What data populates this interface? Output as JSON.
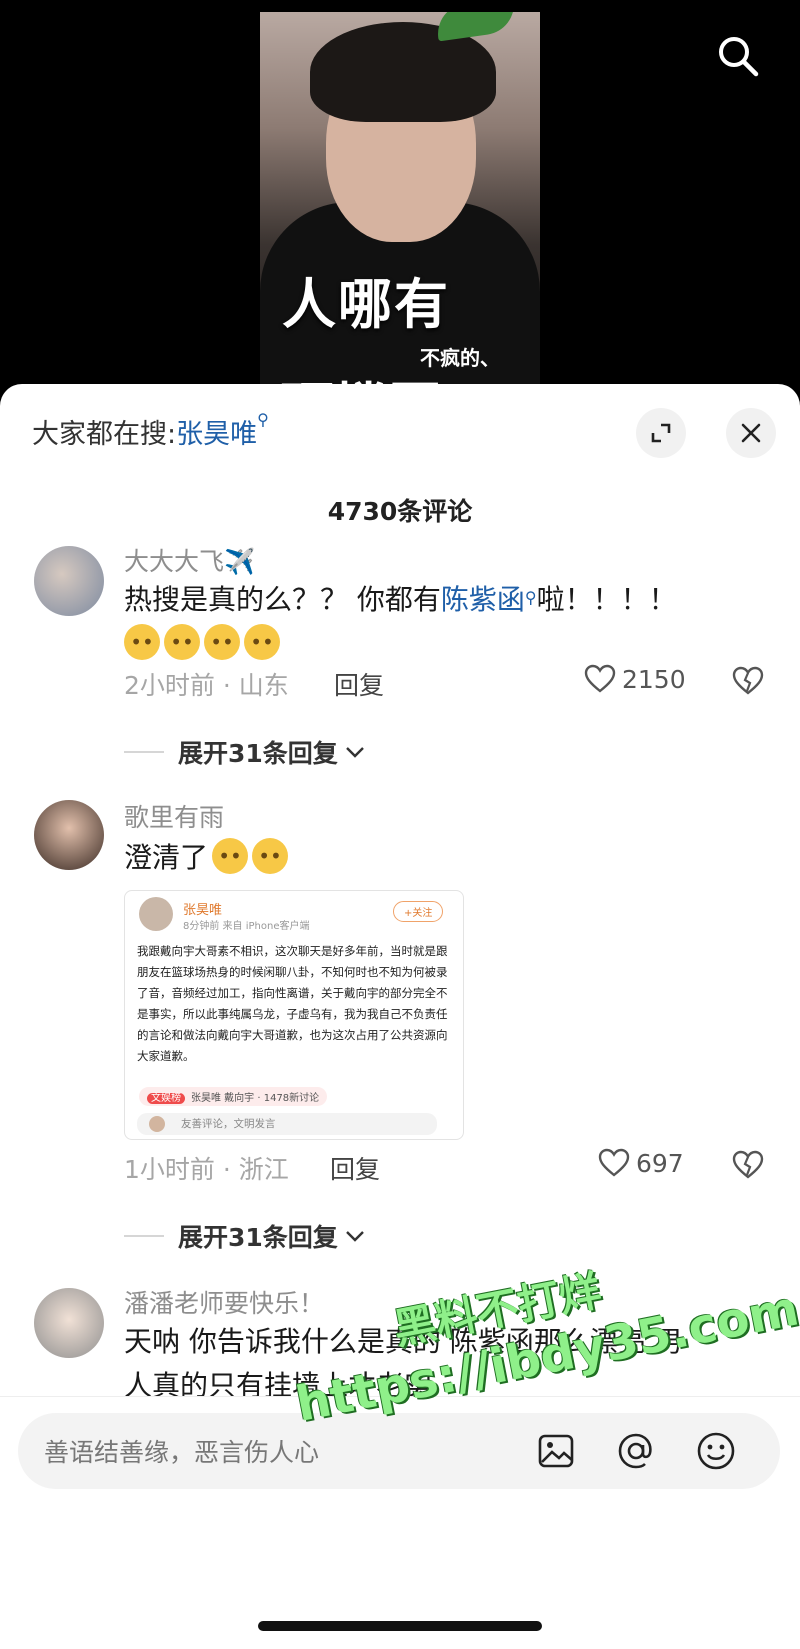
{
  "video": {
    "overlay_big": "人哪有",
    "overlay_small": "不疯的、",
    "overlay_cut": "硬撑罢了"
  },
  "header": {
    "trending_prefix": "大家都在搜:",
    "trending_term": "张昊唯",
    "comment_count": "4730条评论"
  },
  "comments": [
    {
      "username": "大大大飞✈️",
      "text_before": "热搜是真的么？？ 你都有",
      "link": "陈紫函",
      "text_after": "啦！！！！",
      "emoji_count": 4,
      "time_location": "2小时前 · 山东",
      "reply": "回复",
      "likes": "2150",
      "expand": "展开31条回复"
    },
    {
      "username": "歌里有雨",
      "text": "澄清了",
      "time_location": "1小时前 · 浙江",
      "reply": "回复",
      "likes": "697",
      "expand": "展开31条回复",
      "screenshot": {
        "name": "张昊唯",
        "time": "8分钟前  来自 iPhone客户端",
        "follow": "+关注",
        "body": "我跟戴向宇大哥素不相识，这次聊天是好多年前，当时就是跟朋友在篮球场热身的时候闲聊八卦，不知何时也不知为何被录了音，音频经过加工，指向性离谱，关于戴向宇的部分完全不是事实，所以此事纯属乌龙，子虚乌有，我为我自己不负责任的言论和做法向戴向宇大哥道歉，也为这次占用了公共资源向大家道歉。",
        "topic_tag": "文娱榜",
        "topic": "张昊唯 戴向宇 · 1478新讨论",
        "input_placeholder": "友善评论，文明发言"
      }
    },
    {
      "username": "潘潘老师要快乐！",
      "line1": "天呐 你告诉我什么是真的 陈紫函那么漂亮 男",
      "line2": "人真的只有挂墙上才老实"
    }
  ],
  "input": {
    "placeholder": "善语结善缘，恶言伤人心"
  },
  "watermark": {
    "line1": "黑料不打烊",
    "line2": "https://ibdy35.com"
  },
  "colors": {
    "link_blue": "#1f5fa8",
    "watermark_green": "#8ff08a"
  },
  "icons": [
    "search-icon",
    "expand-icon",
    "close-icon",
    "heart-icon",
    "broken-heart-icon",
    "image-icon",
    "at-icon",
    "emoji-icon"
  ]
}
